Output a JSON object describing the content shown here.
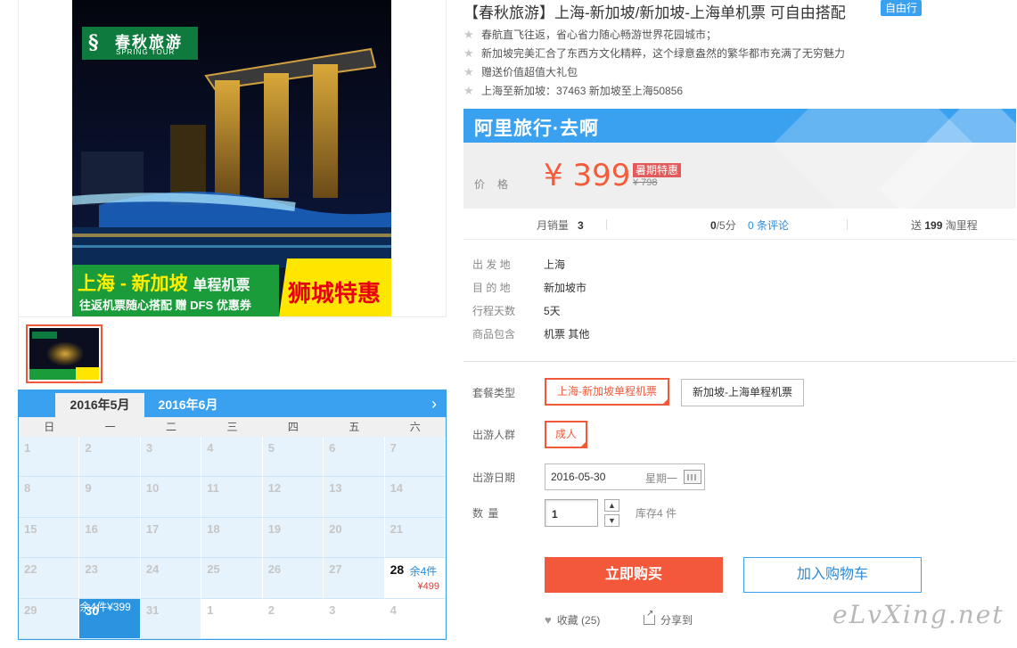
{
  "product": {
    "title": "【春秋旅游】上海-新加坡/新加坡-上海单机票 可自由搭配",
    "badge": "自由行",
    "features": [
      "春航直飞往返，省心省力随心畅游世界花园城市；",
      "新加坡完美汇合了东西方文化精粹，这个绿意盎然的繁华都市充满了无穷魅力",
      "赠送价值超值大礼包",
      "上海至新加坡：37463 新加坡至上海50856"
    ]
  },
  "gallery": {
    "logo_cn": "春秋旅游",
    "logo_en": "SPRING TOUR",
    "banner_main": "上海 - 新加坡",
    "banner_sub": "单程机票",
    "banner_line2": "往返机票随心搭配  赠 DFS 优惠券",
    "banner_promo": "狮城特惠"
  },
  "calendar": {
    "tabs": [
      "2016年5月",
      "2016年6月"
    ],
    "weekdays": [
      "日",
      "一",
      "二",
      "三",
      "四",
      "五",
      "六"
    ],
    "next_arrow": "›",
    "cells": [
      {
        "day": "1"
      },
      {
        "day": "2"
      },
      {
        "day": "3"
      },
      {
        "day": "4"
      },
      {
        "day": "5"
      },
      {
        "day": "6"
      },
      {
        "day": "7"
      },
      {
        "day": "8"
      },
      {
        "day": "9"
      },
      {
        "day": "10"
      },
      {
        "day": "11"
      },
      {
        "day": "12"
      },
      {
        "day": "13"
      },
      {
        "day": "14"
      },
      {
        "day": "15"
      },
      {
        "day": "16"
      },
      {
        "day": "17"
      },
      {
        "day": "18"
      },
      {
        "day": "19"
      },
      {
        "day": "20"
      },
      {
        "day": "21"
      },
      {
        "day": "22"
      },
      {
        "day": "23"
      },
      {
        "day": "24"
      },
      {
        "day": "25"
      },
      {
        "day": "26"
      },
      {
        "day": "27"
      },
      {
        "day": "28",
        "stock": "余4件",
        "price": "¥499",
        "state": "avail"
      },
      {
        "day": "29"
      },
      {
        "day": "30",
        "stock": "余4件",
        "price": "¥399",
        "state": "selected"
      },
      {
        "day": "31"
      },
      {
        "day": "1",
        "state": "next-month"
      },
      {
        "day": "2",
        "state": "next-month"
      },
      {
        "day": "3",
        "state": "next-month"
      },
      {
        "day": "4",
        "state": "next-month"
      }
    ]
  },
  "price_panel": {
    "brand": "阿里旅行·去啊",
    "label": "价格",
    "price": "¥ 399",
    "promo_tag": "暑期特惠",
    "original": "¥ 798"
  },
  "stats": {
    "monthly_sales_label": "月销量",
    "monthly_sales": "3",
    "score": "0",
    "score_unit": "/5分",
    "reviews": "0 条评论",
    "points_prefix": "送",
    "points": "199",
    "points_suffix": "淘里程"
  },
  "info": [
    {
      "k": "出 发 地",
      "v": "上海"
    },
    {
      "k": "目 的 地",
      "v": "新加坡市"
    },
    {
      "k": "行程天数",
      "v": "5天"
    },
    {
      "k": "商品包含",
      "v": "机票  其他"
    }
  ],
  "options": {
    "package_label": "套餐类型",
    "packages": [
      "上海-新加坡单程机票",
      "新加坡-上海单程机票"
    ],
    "traveler_label": "出游人群",
    "traveler": "成人",
    "date_label": "出游日期",
    "date_value": "2016-05-30",
    "date_weekday": "星期一",
    "qty_label": "数    量",
    "qty_value": "1",
    "qty_up": "▲",
    "qty_down": "▼",
    "stock": "库存4 件"
  },
  "actions": {
    "buy": "立即购买",
    "cart": "加入购物车",
    "favorite": "收藏 (25)",
    "share": "分享到"
  },
  "watermark": "eLvXing.net",
  "colors": {
    "accent_blue": "#3aa0f0",
    "price_red": "#f4583a"
  }
}
